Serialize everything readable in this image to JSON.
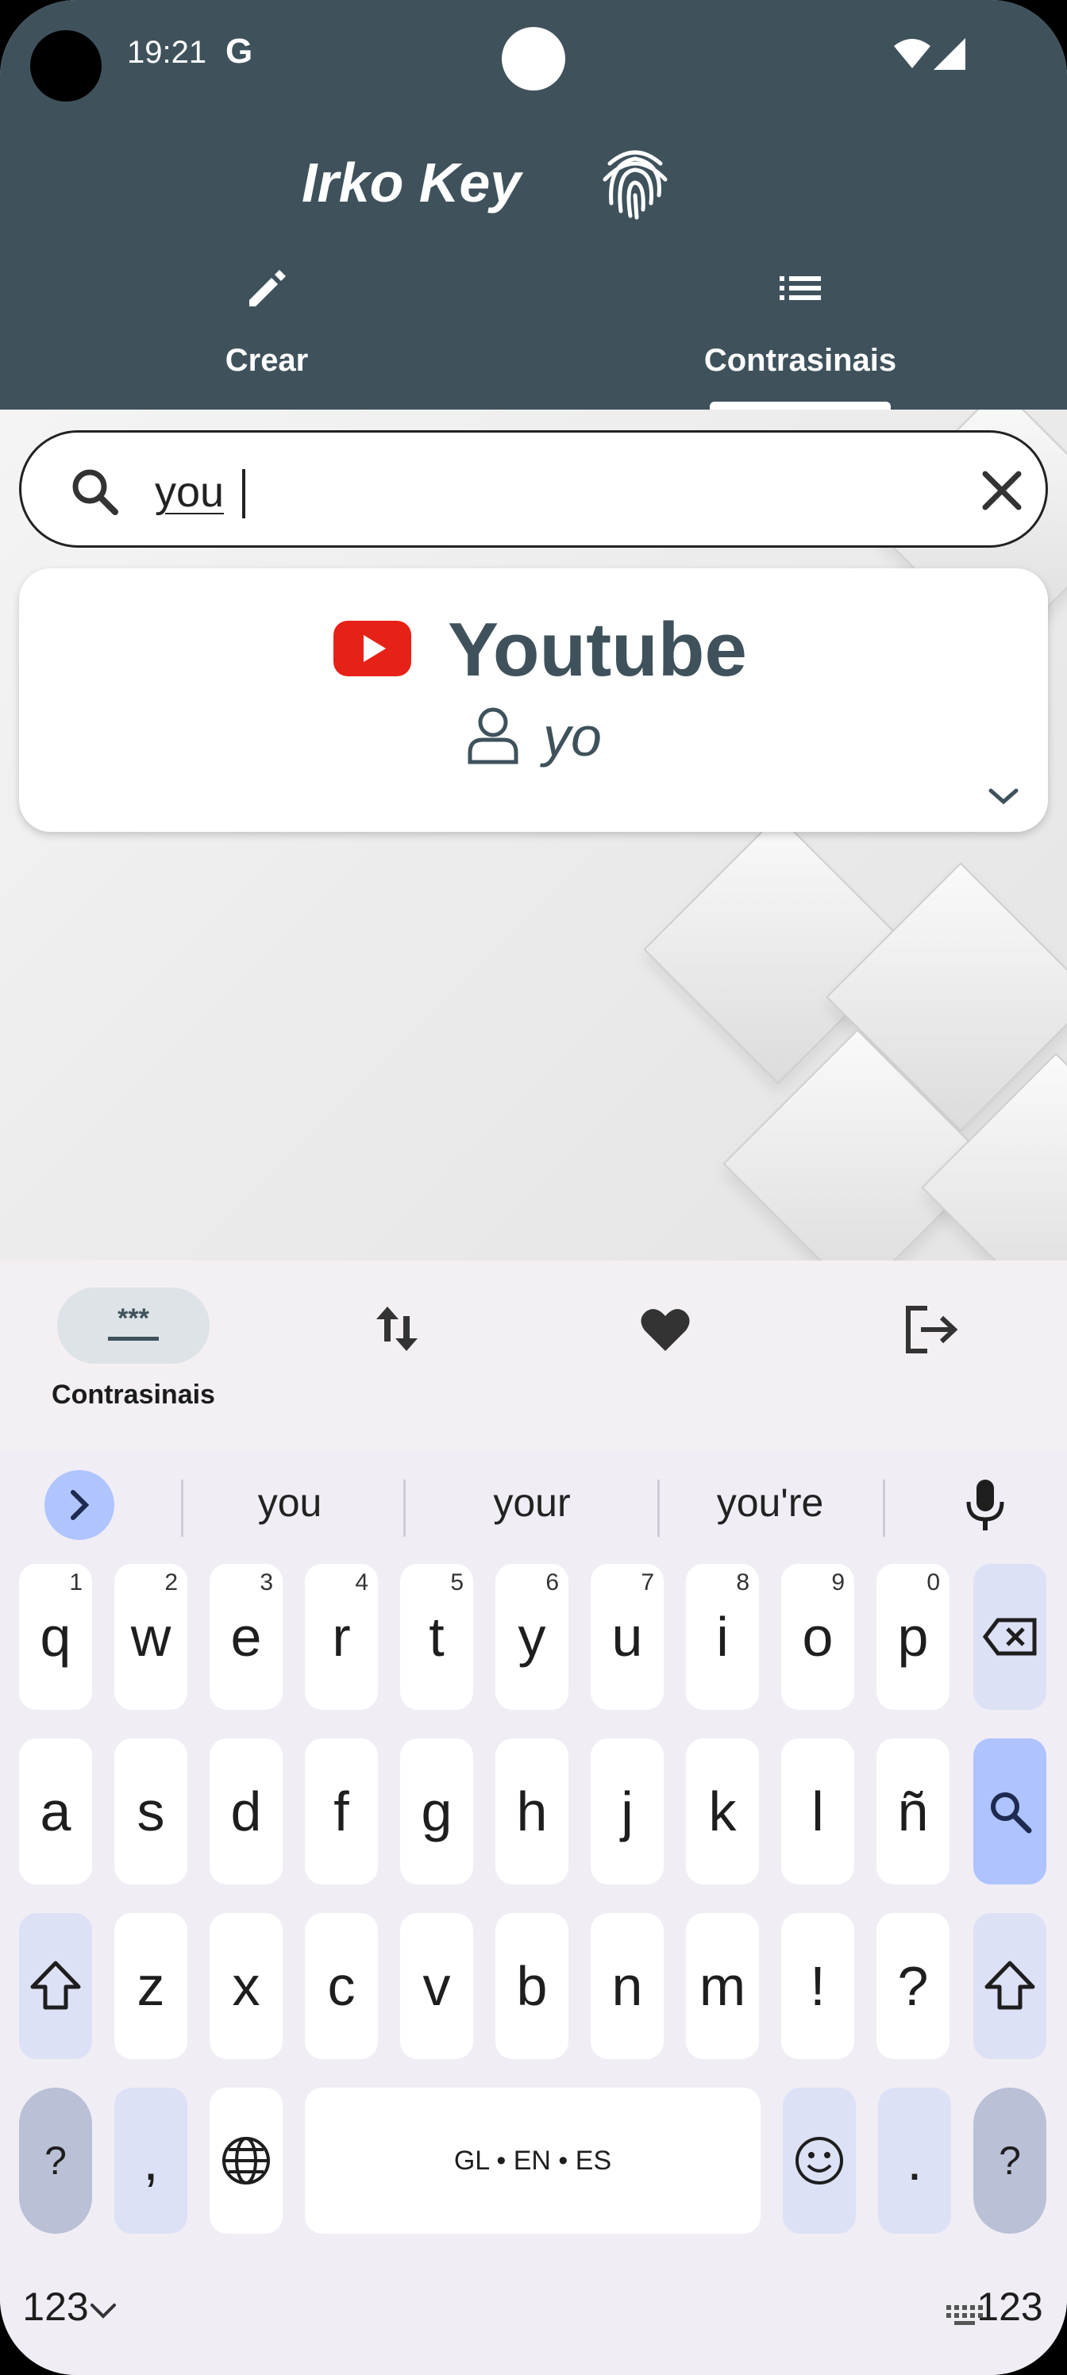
{
  "status_bar": {
    "time": "19:21",
    "carrier_glyph": "G"
  },
  "app": {
    "title": "Irko Key"
  },
  "tabs": [
    {
      "label": "Crear",
      "icon": "pencil-icon"
    },
    {
      "label": "Contrasinais",
      "icon": "list-icon",
      "selected": true
    }
  ],
  "search": {
    "value": "you",
    "placeholder": ""
  },
  "entries": [
    {
      "name": "Youtube",
      "user": "yo",
      "icon": "youtube-logo"
    }
  ],
  "bottom_nav": [
    {
      "label": "Contrasinais",
      "icon": "password-icon",
      "selected": true
    },
    {
      "label": "",
      "icon": "sort-icon"
    },
    {
      "label": "",
      "icon": "heart-icon"
    },
    {
      "label": "",
      "icon": "logout-icon"
    }
  ],
  "keyboard": {
    "suggestions": [
      "you",
      "your",
      "you're"
    ],
    "row1": [
      {
        "key": "q",
        "digit": "1"
      },
      {
        "key": "w",
        "digit": "2"
      },
      {
        "key": "e",
        "digit": "3"
      },
      {
        "key": "r",
        "digit": "4"
      },
      {
        "key": "t",
        "digit": "5"
      },
      {
        "key": "y",
        "digit": "6"
      },
      {
        "key": "u",
        "digit": "7"
      },
      {
        "key": "i",
        "digit": "8"
      },
      {
        "key": "o",
        "digit": "9"
      },
      {
        "key": "p",
        "digit": "0"
      }
    ],
    "row2": [
      "a",
      "s",
      "d",
      "f",
      "g",
      "h",
      "j",
      "k",
      "l",
      "ñ"
    ],
    "row3": [
      "z",
      "x",
      "c",
      "v",
      "b",
      "n",
      "m",
      "!",
      "?"
    ],
    "symbols_label": "?123",
    "comma": ",",
    "period": ".",
    "space_label": "GL • EN • ES"
  },
  "colors": {
    "header": "#3f525c",
    "accent_key": "#aec3ff",
    "youtube_red": "#e62117"
  }
}
